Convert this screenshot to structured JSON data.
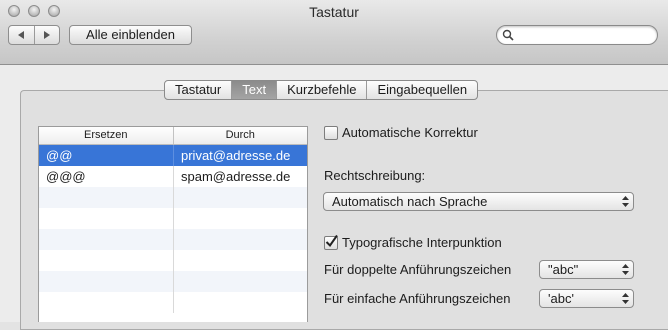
{
  "window": {
    "title": "Tastatur"
  },
  "toolbar": {
    "show_all_label": "Alle einblenden",
    "search_value": "",
    "search_placeholder": ""
  },
  "tabs": [
    {
      "label": "Tastatur",
      "active": false
    },
    {
      "label": "Text",
      "active": true
    },
    {
      "label": "Kurzbefehle",
      "active": false
    },
    {
      "label": "Eingabequellen",
      "active": false
    }
  ],
  "replacements": {
    "headers": [
      "Ersetzen",
      "Durch"
    ],
    "rows": [
      {
        "replace": "@@",
        "with": "privat@adresse.de",
        "selected": true
      },
      {
        "replace": "@@@",
        "with": "spam@adresse.de",
        "selected": false
      }
    ]
  },
  "options": {
    "auto_correct": {
      "label": "Automatische Korrektur",
      "checked": false
    },
    "spelling": {
      "label": "Rechtschreibung:",
      "value": "Automatisch nach Sprache"
    },
    "typographic": {
      "label": "Typografische Interpunktion",
      "checked": true
    },
    "double_quotes": {
      "label": "Für doppelte Anführungszeichen",
      "value": "\"abc\""
    },
    "single_quotes": {
      "label": "Für einfache Anführungszeichen",
      "value": "'abc'"
    }
  },
  "colors": {
    "selection": "#3875d7"
  }
}
